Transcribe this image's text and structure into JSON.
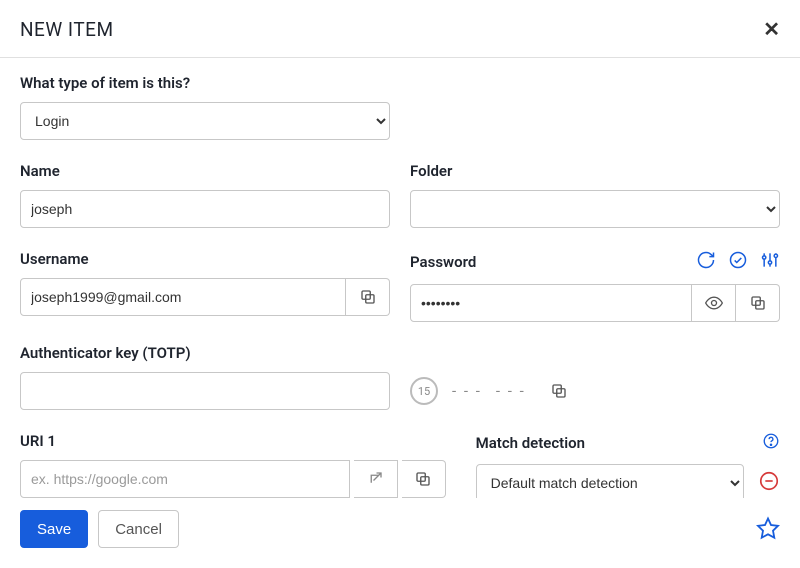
{
  "modal": {
    "title": "NEW ITEM"
  },
  "typeQuestion": {
    "label": "What type of item is this?",
    "selected": "Login"
  },
  "name": {
    "label": "Name",
    "value": "joseph"
  },
  "folder": {
    "label": "Folder",
    "selected": ""
  },
  "username": {
    "label": "Username",
    "value": "joseph1999@gmail.com"
  },
  "password": {
    "label": "Password",
    "value": "••••••••"
  },
  "totp": {
    "label": "Authenticator key (TOTP)",
    "value": "",
    "timer": "15",
    "code1": "- - -",
    "code2": "- - -"
  },
  "uri": {
    "label": "URI 1",
    "placeholder": "ex. https://google.com",
    "value": ""
  },
  "matchDetection": {
    "label": "Match detection",
    "selected": "Default match detection"
  },
  "footer": {
    "save": "Save",
    "cancel": "Cancel"
  }
}
